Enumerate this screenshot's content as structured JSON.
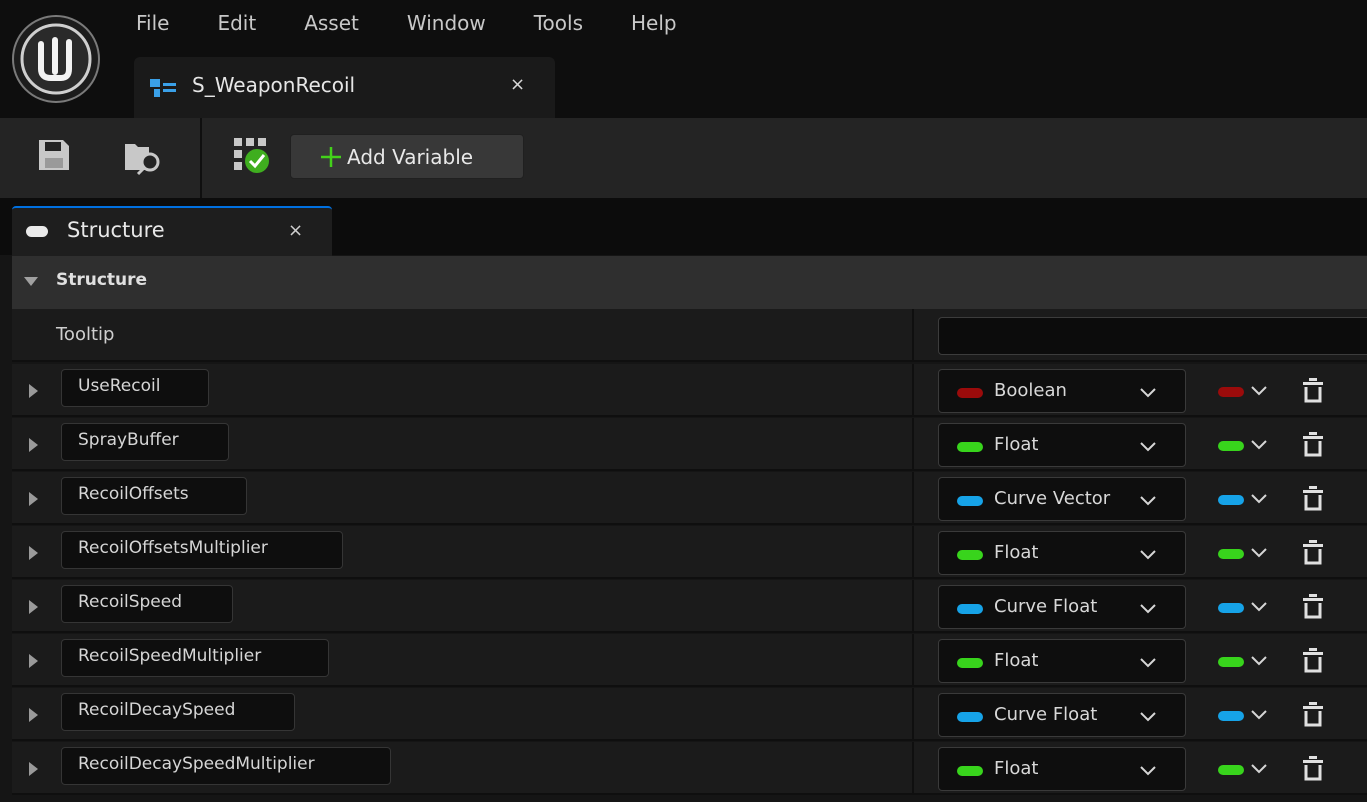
{
  "menu": [
    "File",
    "Edit",
    "Asset",
    "Window",
    "Tools",
    "Help"
  ],
  "document_tab": {
    "label": "S_WeaponRecoil",
    "icon": "user-defined-struct-icon",
    "close_glyph": "×"
  },
  "toolbar": {
    "add_variable_label": "Add Variable"
  },
  "panel_tab": {
    "label": "Structure",
    "close_glyph": "×"
  },
  "category": {
    "label": "Structure"
  },
  "tooltip": {
    "label": "Tooltip",
    "value": ""
  },
  "colors": {
    "boolean": "#9b0b0b",
    "float": "#38d41c",
    "curve": "#16a3e8"
  },
  "variables": [
    {
      "name": "UseRecoil",
      "type": "Boolean",
      "color": "#9b0b0b"
    },
    {
      "name": "SprayBuffer",
      "type": "Float",
      "color": "#38d41c"
    },
    {
      "name": "RecoilOffsets",
      "type": "Curve Vector",
      "color": "#16a3e8"
    },
    {
      "name": "RecoilOffsetsMultiplier",
      "type": "Float",
      "color": "#38d41c"
    },
    {
      "name": "RecoilSpeed",
      "type": "Curve Float",
      "color": "#16a3e8"
    },
    {
      "name": "RecoilSpeedMultiplier",
      "type": "Float",
      "color": "#38d41c"
    },
    {
      "name": "RecoilDecaySpeed",
      "type": "Curve Float",
      "color": "#16a3e8"
    },
    {
      "name": "RecoilDecaySpeedMultiplier",
      "type": "Float",
      "color": "#38d41c"
    }
  ]
}
